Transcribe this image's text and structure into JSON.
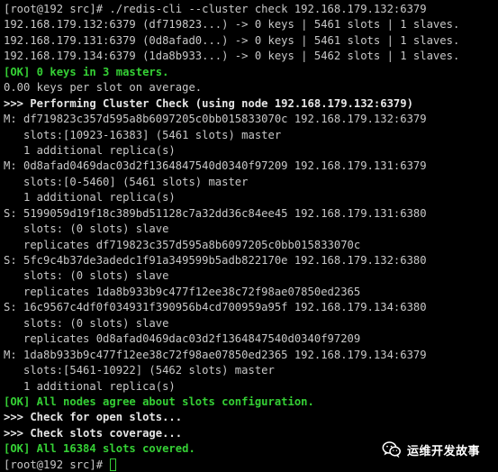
{
  "terminal": {
    "lines": [
      {
        "text": "[root@192 src]# ./redis-cli --cluster check 192.168.179.132:6379",
        "style": "normal"
      },
      {
        "text": "192.168.179.132:6379 (df719823...) -> 0 keys | 5461 slots | 1 slaves.",
        "style": "normal"
      },
      {
        "text": "192.168.179.131:6379 (0d8afad0...) -> 0 keys | 5461 slots | 1 slaves.",
        "style": "normal"
      },
      {
        "text": "192.168.179.134:6379 (1da8b933...) -> 0 keys | 5462 slots | 1 slaves.",
        "style": "normal"
      },
      {
        "text": "[OK] 0 keys in 3 masters.",
        "style": "ok"
      },
      {
        "text": "0.00 keys per slot on average.",
        "style": "normal"
      },
      {
        "text": ">>> Performing Cluster Check (using node 192.168.179.132:6379)",
        "style": "bold"
      },
      {
        "text": "M: df719823c357d595a8b6097205c0bb015833070c 192.168.179.132:6379",
        "style": "normal"
      },
      {
        "text": "   slots:[10923-16383] (5461 slots) master",
        "style": "normal"
      },
      {
        "text": "   1 additional replica(s)",
        "style": "normal"
      },
      {
        "text": "M: 0d8afad0469dac03d2f1364847540d0340f97209 192.168.179.131:6379",
        "style": "normal"
      },
      {
        "text": "   slots:[0-5460] (5461 slots) master",
        "style": "normal"
      },
      {
        "text": "   1 additional replica(s)",
        "style": "normal"
      },
      {
        "text": "S: 5199059d19f18c389bd51128c7a32dd36c84ee45 192.168.179.131:6380",
        "style": "normal"
      },
      {
        "text": "   slots: (0 slots) slave",
        "style": "normal"
      },
      {
        "text": "   replicates df719823c357d595a8b6097205c0bb015833070c",
        "style": "normal"
      },
      {
        "text": "S: 5fc9c4b37de3adedc1f91a349599b5adb822170e 192.168.179.132:6380",
        "style": "normal"
      },
      {
        "text": "   slots: (0 slots) slave",
        "style": "normal"
      },
      {
        "text": "   replicates 1da8b933b9c477f12ee38c72f98ae07850ed2365",
        "style": "normal"
      },
      {
        "text": "S: 16c9567c4df0f034931f390956b4cd700959a95f 192.168.179.134:6380",
        "style": "normal"
      },
      {
        "text": "   slots: (0 slots) slave",
        "style": "normal"
      },
      {
        "text": "   replicates 0d8afad0469dac03d2f1364847540d0340f97209",
        "style": "normal"
      },
      {
        "text": "M: 1da8b933b9c477f12ee38c72f98ae07850ed2365 192.168.179.134:6379",
        "style": "normal"
      },
      {
        "text": "   slots:[5461-10922] (5462 slots) master",
        "style": "normal"
      },
      {
        "text": "   1 additional replica(s)",
        "style": "normal"
      },
      {
        "text": "[OK] All nodes agree about slots configuration.",
        "style": "ok"
      },
      {
        "text": ">>> Check for open slots...",
        "style": "bold"
      },
      {
        "text": ">>> Check slots coverage...",
        "style": "bold"
      },
      {
        "text": "[OK] All 16384 slots covered.",
        "style": "ok"
      },
      {
        "text": "[root@192 src]# ",
        "style": "normal",
        "cursor": true
      }
    ]
  },
  "watermark": {
    "text": "运维开发故事",
    "icon": "wechat-icon"
  },
  "colors": {
    "background": "#000000",
    "text": "#c8c8c8",
    "ok": "#35d035",
    "bold": "#e6e6e6"
  }
}
